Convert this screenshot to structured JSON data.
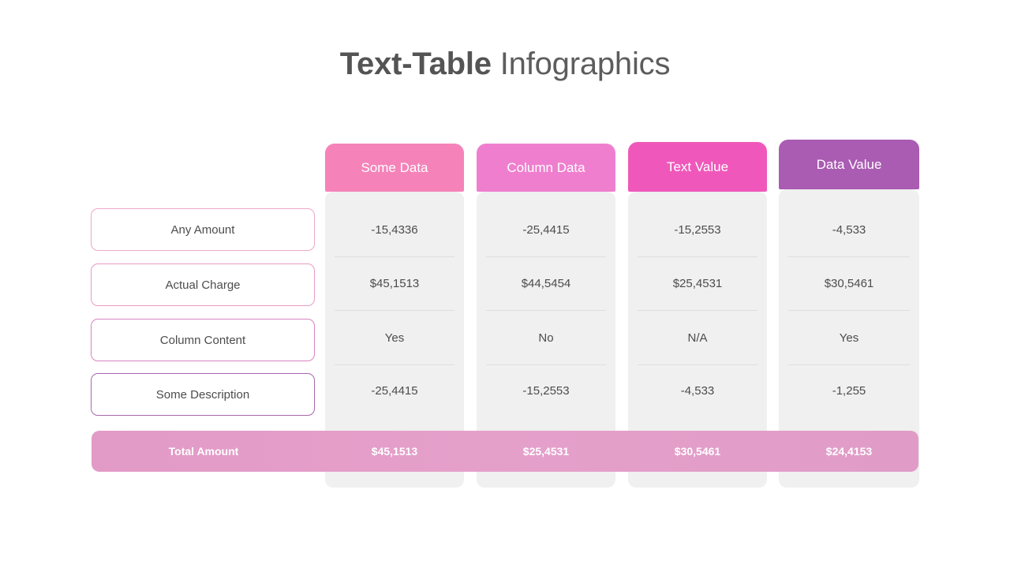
{
  "title": {
    "bold_part": "Text-Table",
    "light_part": " Infographics"
  },
  "colors": {
    "header_1": "#f583b9",
    "header_2": "#ef7fce",
    "header_3": "#ef58ba",
    "header_4": "#aa5bb2",
    "card_bg": "#eff0ef",
    "total_bar": "#e29ac6",
    "text": "#4c4c4c",
    "title": "#5b5b5b",
    "row_border_1": "#f0a8c8",
    "row_border_2": "#e79bc4",
    "row_border_3": "#d983bf",
    "row_border_4": "#a868ab"
  },
  "row_labels": [
    {
      "label": "Any Amount"
    },
    {
      "label": "Actual Charge"
    },
    {
      "label": "Column Content"
    },
    {
      "label": "Some Description"
    }
  ],
  "columns": [
    {
      "header": "Some Data",
      "cells": [
        "-15,4336",
        "$45,1513",
        "Yes",
        "-25,4415"
      ],
      "total": "$45,1513"
    },
    {
      "header": "Column Data",
      "cells": [
        "-25,4415",
        "$44,5454",
        "No",
        "-15,2553"
      ],
      "total": "$25,4531"
    },
    {
      "header": "Text Value",
      "cells": [
        "-15,2553",
        "$25,4531",
        "N/A",
        "-4,533"
      ],
      "total": "$30,5461"
    },
    {
      "header": "Data Value",
      "cells": [
        "-4,533",
        "$30,5461",
        "Yes",
        "-1,255"
      ],
      "total": "$24,4153"
    }
  ],
  "total_row": {
    "label": "Total Amount"
  }
}
